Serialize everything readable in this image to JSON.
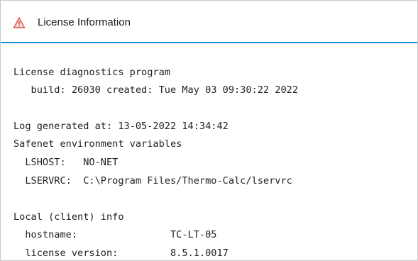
{
  "window": {
    "title": "License Information",
    "icon": "warning-triangle-icon",
    "accent_color": "#1f8fd6",
    "icon_color": "#d9534f"
  },
  "console": {
    "lines": [
      "License diagnostics program",
      "   build: 26030 created: Tue May 03 09:30:22 2022",
      "Log generated at: 13-05-2022 14:34:42",
      "Safenet environment variables",
      "  LSHOST:   NO-NET",
      "  LSERVRC:  C:\\Program Files/Thermo-Calc/lservrc",
      "Local (client) info",
      "  hostname:                TC-LT-05",
      "  license version:         8.5.1.0017"
    ]
  }
}
